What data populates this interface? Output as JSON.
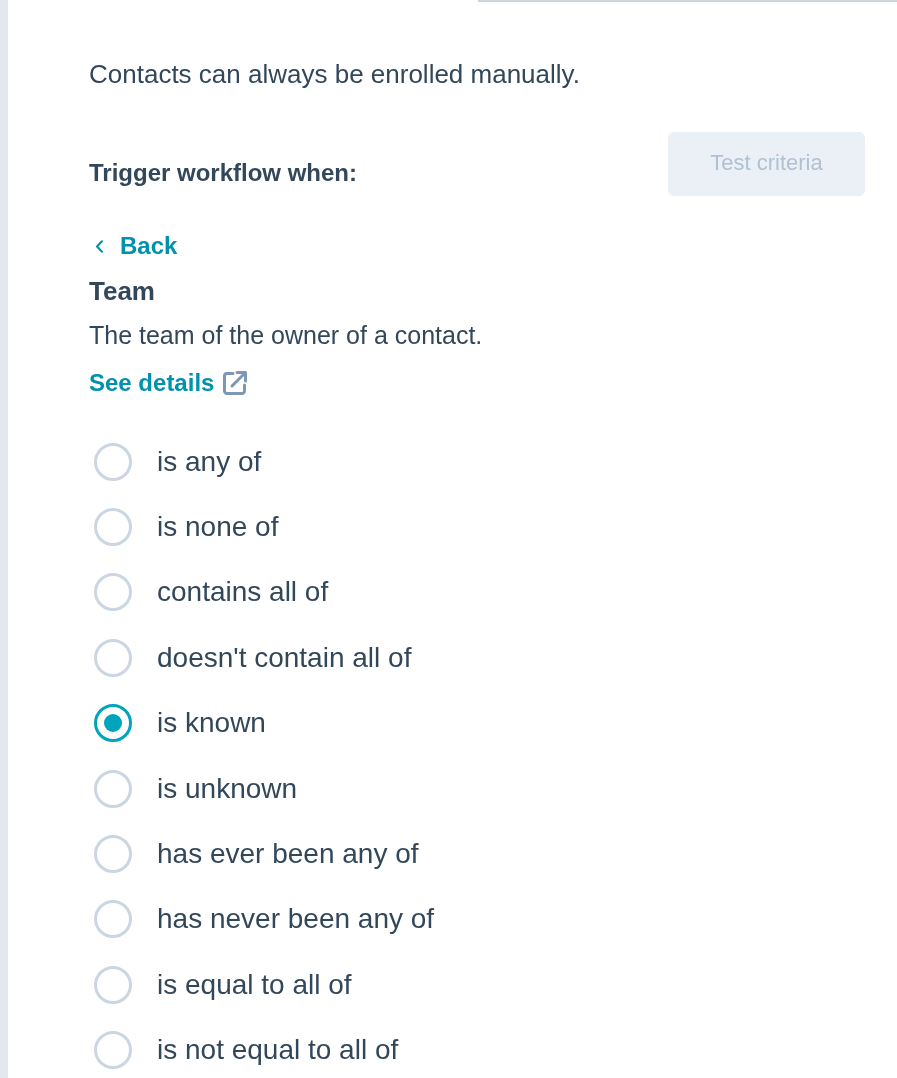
{
  "intro": {
    "text": "Contacts can always be enrolled manually."
  },
  "trigger": {
    "label": "Trigger workflow when:",
    "test_button": {
      "label": "Test criteria",
      "disabled": true
    }
  },
  "back_link": {
    "label": "Back"
  },
  "property": {
    "name": "Team",
    "description": "The team of the owner of a contact.",
    "details_link": "See details"
  },
  "operators": [
    {
      "label": "is any of",
      "selected": false
    },
    {
      "label": "is none of",
      "selected": false
    },
    {
      "label": "contains all of",
      "selected": false
    },
    {
      "label": "doesn't contain all of",
      "selected": false
    },
    {
      "label": "is known",
      "selected": true
    },
    {
      "label": "is unknown",
      "selected": false
    },
    {
      "label": "has ever been any of",
      "selected": false
    },
    {
      "label": "has never been any of",
      "selected": false
    },
    {
      "label": "is equal to all of",
      "selected": false
    },
    {
      "label": "is not equal to all of",
      "selected": false
    }
  ]
}
